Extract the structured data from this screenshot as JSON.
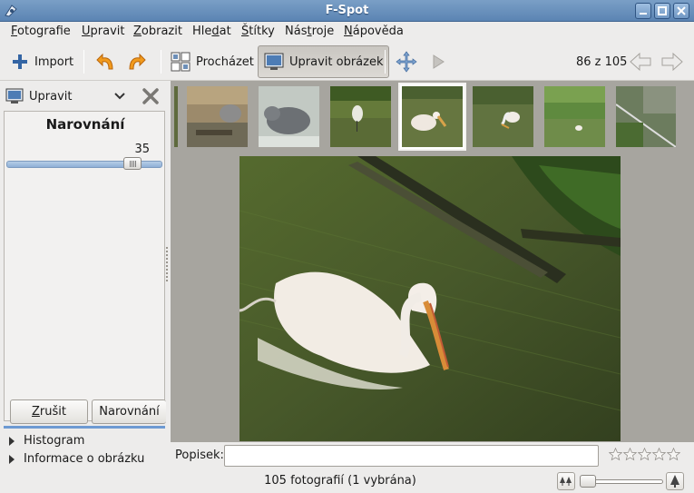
{
  "window": {
    "title": "F-Spot"
  },
  "menu": [
    {
      "pre": "",
      "u": "F",
      "post": "otografie"
    },
    {
      "pre": "",
      "u": "U",
      "post": "pravit"
    },
    {
      "pre": "",
      "u": "Z",
      "post": "obrazit"
    },
    {
      "pre": "Hle",
      "u": "d",
      "post": "at"
    },
    {
      "pre": "",
      "u": "Š",
      "post": "títky"
    },
    {
      "pre": "Nás",
      "u": "t",
      "post": "roje"
    },
    {
      "pre": "",
      "u": "N",
      "post": "ápověda"
    }
  ],
  "toolbar": {
    "import_label": "Import",
    "browse_label": "Procházet",
    "edit_label": "Upravit obrázek",
    "counter": "86 z 105"
  },
  "left": {
    "mode_label": "Upravit",
    "editor_title": "Narovnání",
    "angle_value": "35",
    "angle_level_percent": 85,
    "cancel_label_u": "Z",
    "cancel_label_rest": "rušit",
    "apply_label": "Narovnání",
    "expanders": [
      "Histogram",
      "Informace o obrázku"
    ]
  },
  "caption": {
    "label": "Popisek:",
    "value": ""
  },
  "rating": {
    "stars_filled": 0,
    "stars_total": 5
  },
  "status": {
    "text": "105 fotografií (1 vybrána)"
  },
  "colors": {
    "accent": "#6d9ad2",
    "titlebar": "#5b84b3",
    "filmstrip_bg": "#a7a59f"
  }
}
